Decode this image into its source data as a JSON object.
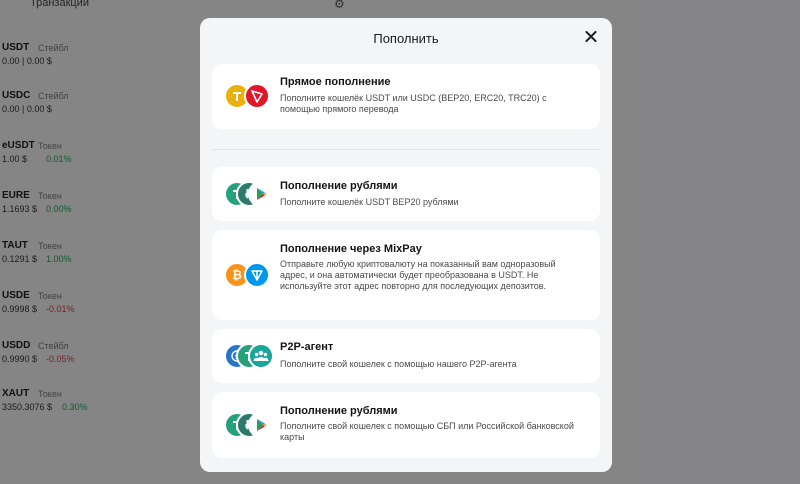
{
  "background": {
    "tabs": [
      "",
      "Транзакции"
    ],
    "rows": [
      {
        "symbol": "USDT",
        "tag": "Стейбл",
        "value": "0.00 | 0.00 $",
        "change": ""
      },
      {
        "symbol": "USDC",
        "tag": "Стейбл",
        "value": "0.00 | 0.00 $",
        "change": ""
      },
      {
        "symbol": "eUSDT",
        "tag": "Токен",
        "value": "1.00 $",
        "change": "0.01%",
        "trend": "up"
      },
      {
        "symbol": "EURE",
        "tag": "Токен",
        "value": "1.1693 $",
        "change": "0.00%",
        "trend": "up"
      },
      {
        "symbol": "TAUT",
        "tag": "Токен",
        "value": "0.1291 $",
        "change": "1.00%",
        "trend": "up"
      },
      {
        "symbol": "USDE",
        "tag": "Токен",
        "value": "0.9998 $",
        "change": "-0.01%",
        "trend": "down"
      },
      {
        "symbol": "USDD",
        "tag": "Стейбл",
        "value": "0.9990 $",
        "change": "-0.05%",
        "trend": "down"
      },
      {
        "symbol": "XAUT",
        "tag": "Токен",
        "value": "3350.3076 $",
        "change": "0.30%",
        "trend": "up"
      }
    ]
  },
  "modal": {
    "title": "Пополнить",
    "options": [
      {
        "title": "Прямое пополнение",
        "description": "Пополните кошелёк USDT или USDC (BEP20, ERC20, TRC20) с помощью прямого перевода",
        "icons": [
          "usdt-coin-icon",
          "tron-icon"
        ]
      },
      {
        "title": "Пополнение рублями",
        "description": "Пополните кошелёк USDT BEP20 рублями",
        "icons": [
          "usdt-coin-icon",
          "ruble-coin-icon",
          "play-store-icon"
        ]
      },
      {
        "title": "Пополнение через MixPay",
        "description": "Отправьте любую криптовалюту на показанный вам одноразовый адрес, и она автоматически будет преобразована в USDT. Не используйте этот адрес повторно для последующих депозитов.",
        "icons": [
          "bitcoin-icon",
          "ton-icon"
        ]
      },
      {
        "title": "P2P-агент",
        "description": "Пополните свой кошелек с помощью нашего P2P-агента",
        "icons": [
          "usdc-coin-icon",
          "usdt-coin-icon",
          "people-icon"
        ]
      },
      {
        "title": "Пополнение рублями",
        "description": "Пополните свой кошелек с помощью СБП или Российской банковской карты",
        "icons": [
          "usdt-coin-icon",
          "ruble-coin-icon",
          "play-store-icon"
        ]
      }
    ]
  },
  "colors": {
    "usdt": "#26a17b",
    "tron": "#e0162b",
    "bitcoin": "#f7931a",
    "ton": "#0098ea",
    "usdc": "#2775ca",
    "people": "#1aa59a",
    "gold": "#e9b10a"
  }
}
